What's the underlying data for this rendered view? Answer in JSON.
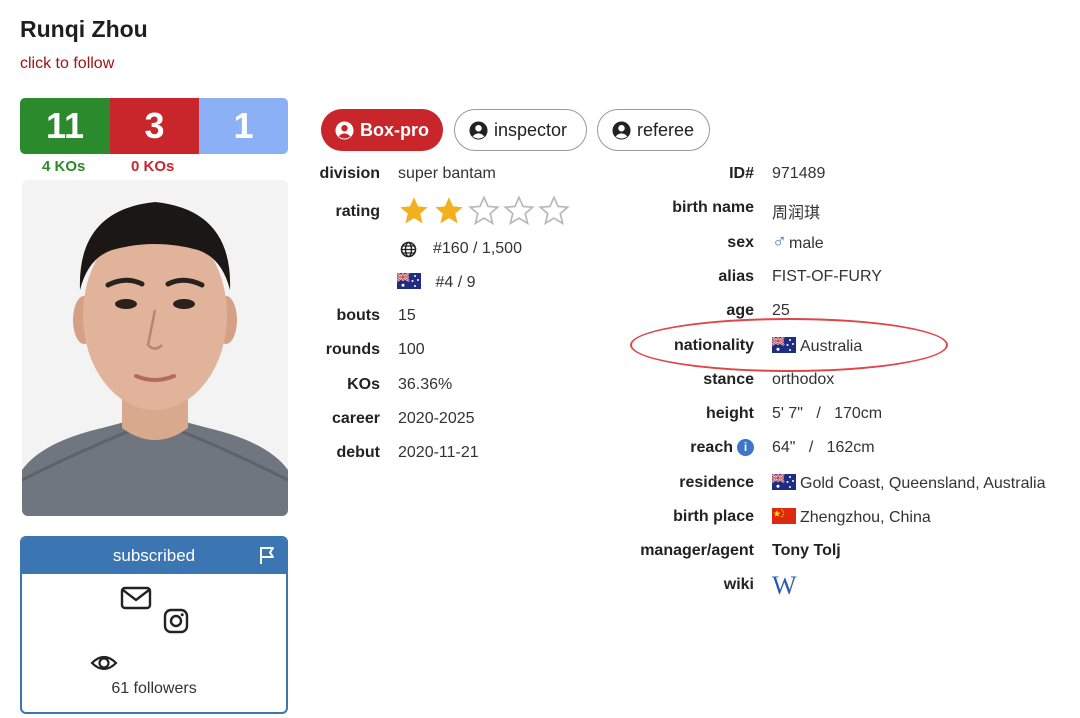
{
  "profile": {
    "name": "Runqi Zhou",
    "follow_label": "click to follow"
  },
  "record": {
    "wins": "11",
    "losses": "3",
    "draws": "1",
    "wins_ko": "4 KOs",
    "losses_ko": "0 KOs"
  },
  "subscribe": {
    "header": "subscribed",
    "followers": "61 followers"
  },
  "roles": [
    "Box-pro",
    "inspector",
    "referee"
  ],
  "left_details": {
    "division_label": "division",
    "division": "super bantam",
    "rating_label": "rating",
    "rating_stars": 2,
    "rating_max": 5,
    "world_rank": "#160 / 1,500",
    "national_rank": "#4 / 9",
    "bouts_label": "bouts",
    "bouts": "15",
    "rounds_label": "rounds",
    "rounds": "100",
    "kos_label": "KOs",
    "kos": "36.36%",
    "career_label": "career",
    "career": "2020-2025",
    "debut_label": "debut",
    "debut": "2020-11-21"
  },
  "right_details": {
    "id_label": "ID#",
    "id": "971489",
    "birth_name_label": "birth name",
    "birth_name": "周润琪",
    "sex_label": "sex",
    "sex": "male",
    "alias_label": "alias",
    "alias": "FIST-OF-FURY",
    "age_label": "age",
    "age": "25",
    "nationality_label": "nationality",
    "nationality": "Australia",
    "stance_label": "stance",
    "stance": "orthodox",
    "height_label": "height",
    "height": "5' 7\"   /   170cm",
    "reach_label": "reach",
    "reach": "64\"   /   162cm",
    "residence_label": "residence",
    "residence": "Gold Coast, Queensland, Australia",
    "birth_place_label": "birth place",
    "birth_place": "Zhengzhou, China",
    "manager_label": "manager/agent",
    "manager": "Tony Tolj",
    "wiki_label": "wiki",
    "wiki_glyph": "W"
  },
  "colors": {
    "win": "#2b8a2b",
    "loss": "#c8262a",
    "draw": "#8cb0f5",
    "accent_blue": "#3b76b3",
    "star": "#f2b01e",
    "highlight": "#e0454a"
  }
}
